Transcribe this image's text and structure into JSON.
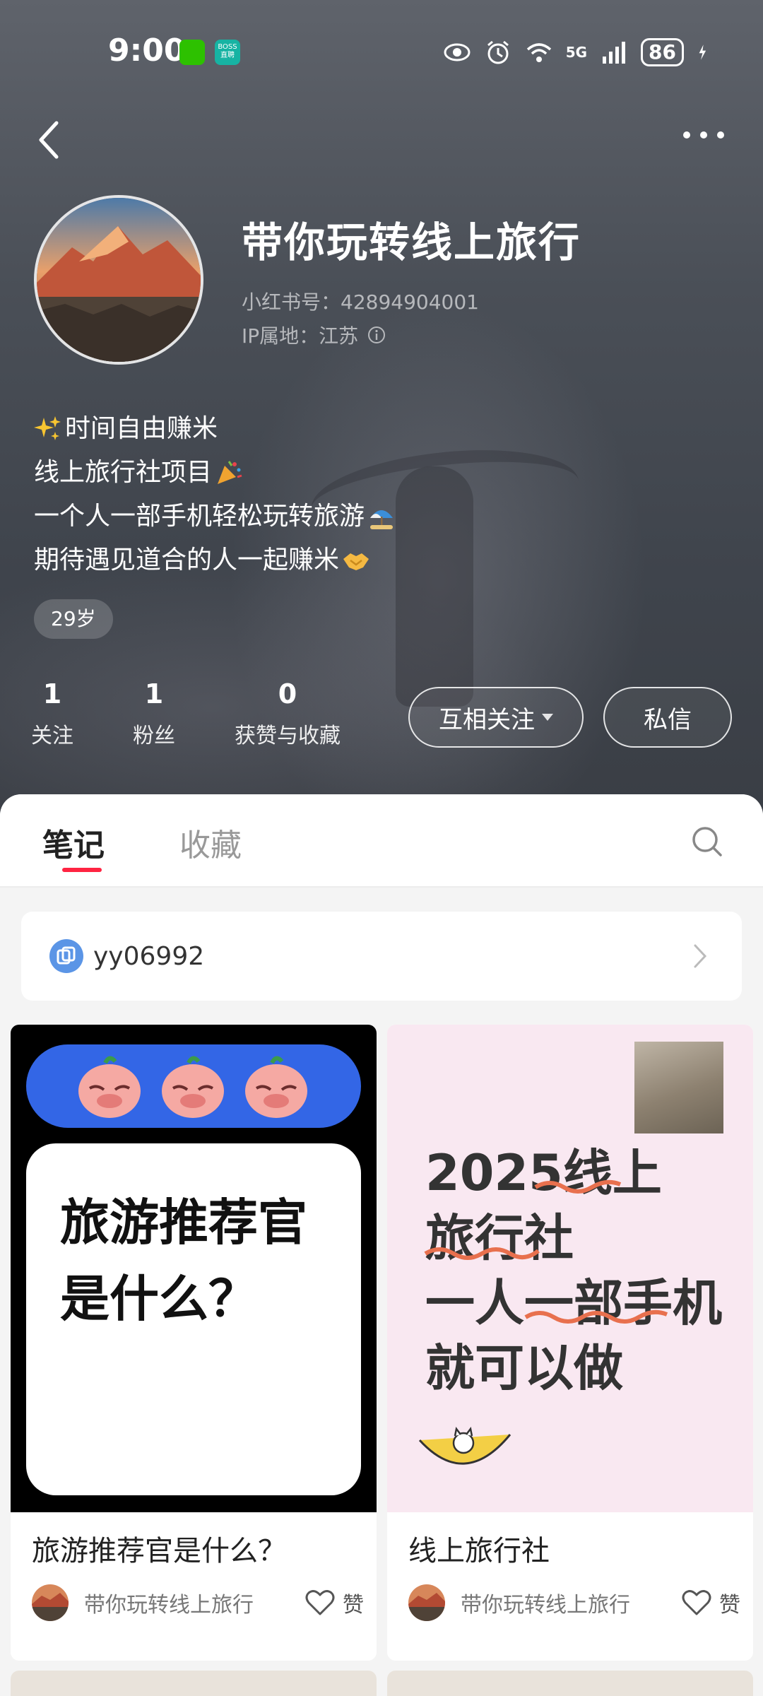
{
  "status_bar": {
    "time": "9:00",
    "boss_label": "BOSS\n直聘",
    "network": "5G",
    "battery": "86"
  },
  "profile": {
    "name": "带你玩转线上旅行",
    "id_text": "小红书号：42894904001",
    "ip_text": "IP属地：江苏",
    "bio": [
      "时间自由赚米",
      "线上旅行社项目",
      "一个人一部手机轻松玩转旅游",
      "期待遇见道合的人一起赚米"
    ],
    "age_tag": "29岁"
  },
  "stats": [
    {
      "value": "1",
      "label": "关注"
    },
    {
      "value": "1",
      "label": "粉丝"
    },
    {
      "value": "0",
      "label": "获赞与收藏"
    }
  ],
  "actions": {
    "follow_label": "互相关注",
    "message_label": "私信"
  },
  "tabs": [
    {
      "label": "笔记",
      "active": true
    },
    {
      "label": "收藏",
      "active": false
    }
  ],
  "collection": {
    "label": "yy06992"
  },
  "notes": [
    {
      "title": "旅游推荐官是什么？",
      "cover_lines": [
        "旅游推荐官",
        "是什么？"
      ],
      "author": "带你玩转线上旅行",
      "like_label": "赞"
    },
    {
      "title": "线上旅行社",
      "cover_lines": [
        "2025线上",
        "旅行社",
        "一人一部手机",
        "就可以做"
      ],
      "author": "带你玩转线上旅行",
      "like_label": "赞"
    }
  ],
  "colors": {
    "accent": "#ff2442",
    "hero_bg": "#4a4f57",
    "cover1_pill": "#3366e6",
    "cover2_bg": "#f9e8f1"
  }
}
